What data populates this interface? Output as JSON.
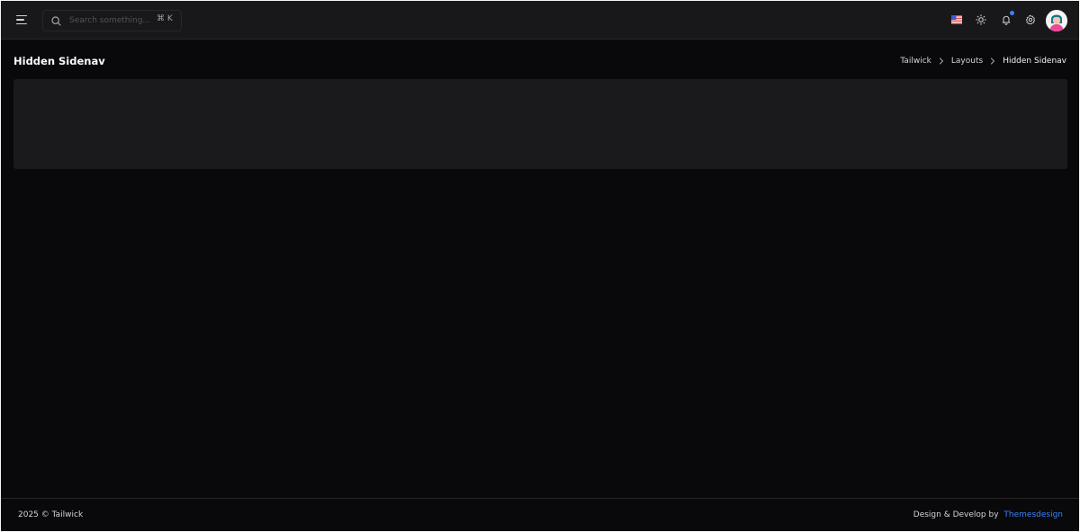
{
  "topbar": {
    "search": {
      "placeholder": "Search something...",
      "shortcut": "⌘ K"
    },
    "icons": [
      "menu-icon",
      "search-icon",
      "us-flag-icon",
      "sun-icon",
      "bell-icon",
      "gear-icon"
    ],
    "notification_dot_color": "#3b82f6"
  },
  "page": {
    "title": "Hidden Sidenav",
    "breadcrumb": [
      "Tailwick",
      "Layouts",
      "Hidden Sidenav"
    ]
  },
  "footer": {
    "copyright": "2025 © Tailwick",
    "credit_prefix": "Design & Develop by",
    "credit_link": "Themesdesign"
  },
  "colors": {
    "background": "#09090b",
    "topbar": "#18181b",
    "card": "#1a1a1c",
    "accent": "#3b82f6"
  }
}
